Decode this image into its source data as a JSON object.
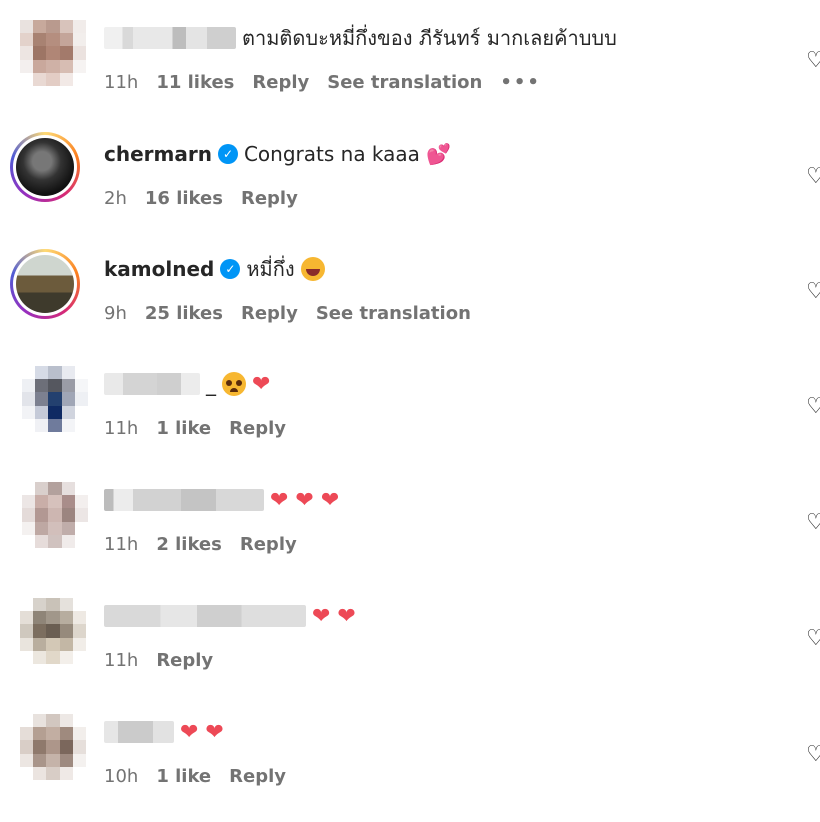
{
  "comments": [
    {
      "text": "ตามติดบะหมี่กึ่งของ ภีรันทร์ มากเลยค้าบบบ",
      "time": "11h",
      "likes": "11 likes",
      "reply": "Reply",
      "translate": "See translation",
      "more": "•••"
    },
    {
      "username": "chermarn",
      "verified": "✓",
      "text": "Congrats na kaaa",
      "emoji": "💕",
      "time": "2h",
      "likes": "16 likes",
      "reply": "Reply"
    },
    {
      "username": "kamolned",
      "verified": "✓",
      "text": "หมี่กึ่ง",
      "time": "9h",
      "likes": "25 likes",
      "reply": "Reply",
      "translate": "See translation"
    },
    {
      "suffix": "_",
      "hearts": "❤",
      "time": "11h",
      "likes": "1 like",
      "reply": "Reply"
    },
    {
      "hearts": "❤ ❤ ❤",
      "time": "11h",
      "likes": "2 likes",
      "reply": "Reply"
    },
    {
      "hearts": "❤ ❤",
      "time": "11h",
      "reply": "Reply"
    },
    {
      "hearts": "❤ ❤",
      "time": "10h",
      "likes": "1 like",
      "reply": "Reply"
    }
  ],
  "icons": {
    "like": "heart-outline-icon",
    "verified": "verified-badge-icon"
  },
  "colors": {
    "verified": "#0095f6",
    "heart": "#ed4956",
    "meta": "#737373",
    "text": "#262626"
  }
}
